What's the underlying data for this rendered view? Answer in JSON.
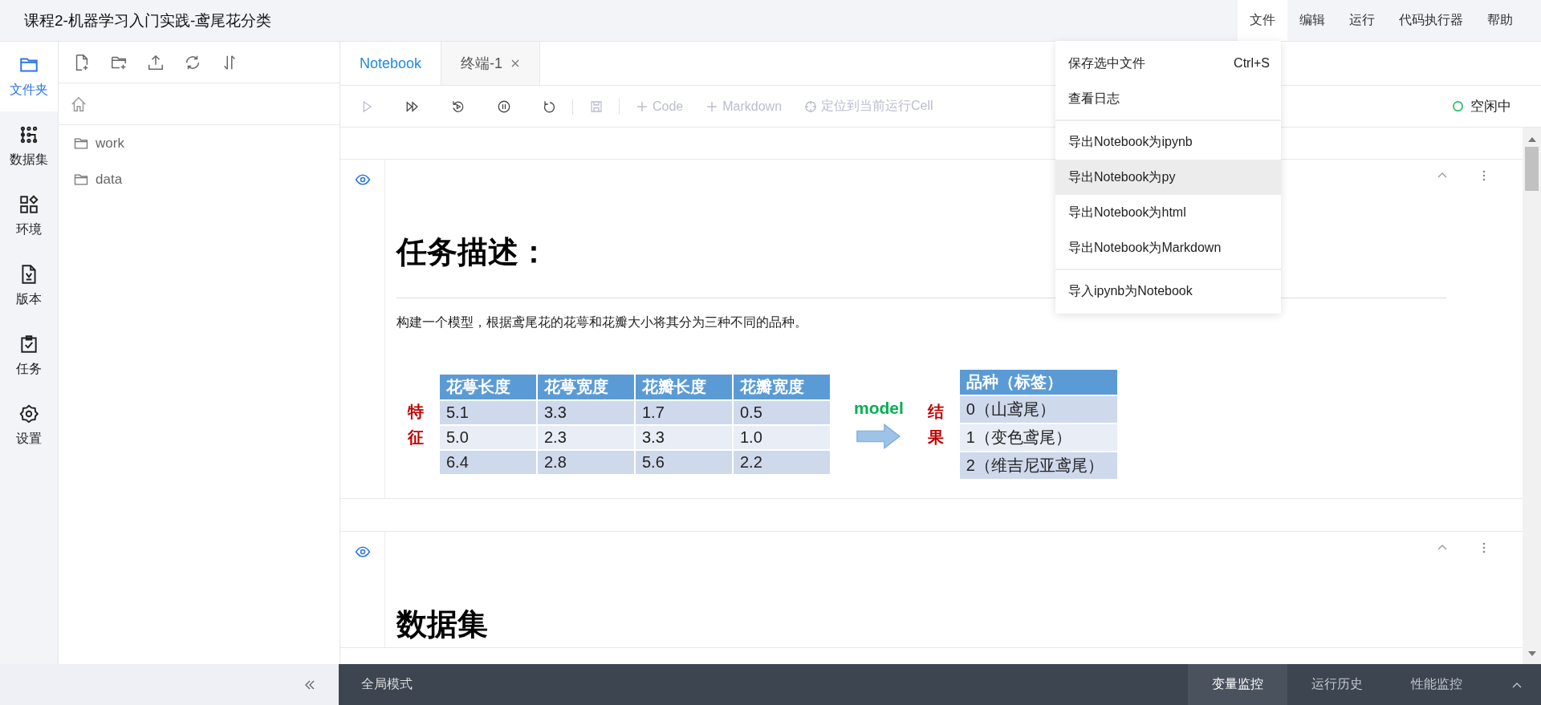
{
  "title": "课程2-机器学习入门实践-鸢尾花分类",
  "menubar": [
    {
      "label": "文件",
      "selected": true
    },
    {
      "label": "编辑",
      "selected": false
    },
    {
      "label": "运行",
      "selected": false
    },
    {
      "label": "代码执行器",
      "selected": false
    },
    {
      "label": "帮助",
      "selected": false
    }
  ],
  "file_menu": [
    {
      "kind": "item",
      "label": "保存选中文件",
      "shortcut": "Ctrl+S",
      "highlighted": false
    },
    {
      "kind": "item",
      "label": "查看日志",
      "highlighted": false
    },
    {
      "kind": "divider"
    },
    {
      "kind": "item",
      "label": "导出Notebook为ipynb",
      "highlighted": false
    },
    {
      "kind": "item",
      "label": "导出Notebook为py",
      "highlighted": true
    },
    {
      "kind": "item",
      "label": "导出Notebook为html",
      "highlighted": false
    },
    {
      "kind": "item",
      "label": "导出Notebook为Markdown",
      "highlighted": false
    },
    {
      "kind": "divider"
    },
    {
      "kind": "item",
      "label": "导入ipynb为Notebook",
      "highlighted": false
    }
  ],
  "sidebar": [
    {
      "label": "文件夹",
      "selected": true
    },
    {
      "label": "数据集",
      "selected": false
    },
    {
      "label": "环境",
      "selected": false
    },
    {
      "label": "版本",
      "selected": false
    },
    {
      "label": "任务",
      "selected": false
    },
    {
      "label": "设置",
      "selected": false
    }
  ],
  "files": [
    {
      "name": "work"
    },
    {
      "name": "data"
    }
  ],
  "tabs": [
    {
      "label": "Notebook",
      "selected": true,
      "closable": false
    },
    {
      "label": "终端-1",
      "selected": false,
      "closable": true
    }
  ],
  "toolbar": [
    {
      "label": "Code",
      "disabled": true
    },
    {
      "label": "Markdown",
      "disabled": true
    },
    {
      "label": "定位到当前运行Cell",
      "disabled": true
    }
  ],
  "kernel_status": "空闲中",
  "cells": [
    {
      "heading": "任务描述：",
      "paragraph": "构建一个模型，根据鸢尾花的花萼和花瓣大小将其分为三种不同的品种。",
      "figure": {
        "features_label": "特征",
        "columns": [
          "花萼长度",
          "花萼宽度",
          "花瓣长度",
          "花瓣宽度"
        ],
        "rows": [
          [
            "5.1",
            "3.3",
            "1.7",
            "0.5"
          ],
          [
            "5.0",
            "2.3",
            "3.3",
            "1.0"
          ],
          [
            "6.4",
            "2.8",
            "5.6",
            "2.2"
          ]
        ],
        "arrow_label": "model",
        "result_label": "结果",
        "result_header": "品种（标签）",
        "results": [
          "0（山鸢尾）",
          "1（变色鸢尾）",
          "2（维吉尼亚鸢尾）"
        ]
      }
    },
    {
      "heading": "数据集"
    }
  ],
  "bottom_bar": {
    "global_mode": "全局模式",
    "tabs": [
      {
        "label": "变量监控",
        "selected": true
      },
      {
        "label": "运行历史",
        "selected": false
      },
      {
        "label": "性能监控",
        "selected": false
      }
    ]
  }
}
